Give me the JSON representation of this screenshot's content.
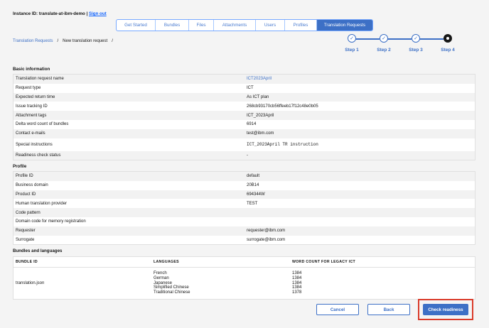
{
  "header": {
    "instance_text": "Instance ID: translate-at-ibm-demo | ",
    "sign_out": "Sign out"
  },
  "tabs": [
    {
      "label": "Get Started",
      "active": false
    },
    {
      "label": "Bundles",
      "active": false
    },
    {
      "label": "Files",
      "active": false
    },
    {
      "label": "Attachments",
      "active": false
    },
    {
      "label": "Users",
      "active": false
    },
    {
      "label": "Profiles",
      "active": false
    },
    {
      "label": "Translation Requests",
      "active": true
    }
  ],
  "breadcrumb": {
    "parent": "Translation Requests",
    "sep": "/",
    "current": "New translation request"
  },
  "stepper": {
    "steps": [
      "Step 1",
      "Step 2",
      "Step 3",
      "Step 4"
    ],
    "current_step": 4
  },
  "basic": {
    "title": "Basic information",
    "rows": [
      {
        "key": "Translation request name",
        "value": "ICT2023April"
      },
      {
        "key": "Request type",
        "value": "ICT"
      },
      {
        "key": "Expected return time",
        "value": "As ICT plan"
      },
      {
        "key": "Issue tracking ID",
        "value": "268cb93170cb56ffeeb17f12c48e0b05"
      },
      {
        "key": "Attachment tags",
        "value": "ICT_2023April"
      },
      {
        "key": "Delta word count of bundles",
        "value": "6914"
      },
      {
        "key": "Contact e-mails",
        "value": "test@ibm.com"
      },
      {
        "key": "Special instructions",
        "value": "ICT_2023April TR instruction"
      },
      {
        "key": "Readiness check status",
        "value": "-"
      }
    ]
  },
  "profile": {
    "title": "Profile",
    "rows": [
      {
        "key": "Profile ID",
        "value": "default"
      },
      {
        "key": "Business domain",
        "value": "20B14"
      },
      {
        "key": "Product ID",
        "value": "694344W"
      },
      {
        "key": "Human translation provider",
        "value": "TEST"
      },
      {
        "key": "Code pattern",
        "value": ""
      },
      {
        "key": "Domain code for memory registration",
        "value": ""
      },
      {
        "key": "Requester",
        "value": "requester@ibm.com"
      },
      {
        "key": "Surrogate",
        "value": "surrogate@ibm.com"
      }
    ]
  },
  "bundles": {
    "title": "Bundles and languages",
    "headers": [
      "BUNDLE ID",
      "LANGUAGES",
      "WORD COUNT FOR LEGACY ICT"
    ],
    "bundle_id": "translation.json",
    "languages": [
      "French",
      "German",
      "Japanese",
      "Simplified Chinese",
      "Traditional Chinese"
    ],
    "word_counts": [
      "1384",
      "1384",
      "1384",
      "1384",
      "1378"
    ]
  },
  "buttons": {
    "cancel": "Cancel",
    "back": "Back",
    "check": "Check readiness"
  },
  "colors": {
    "accent": "#3d70c6",
    "highlight": "#da3b2a"
  }
}
